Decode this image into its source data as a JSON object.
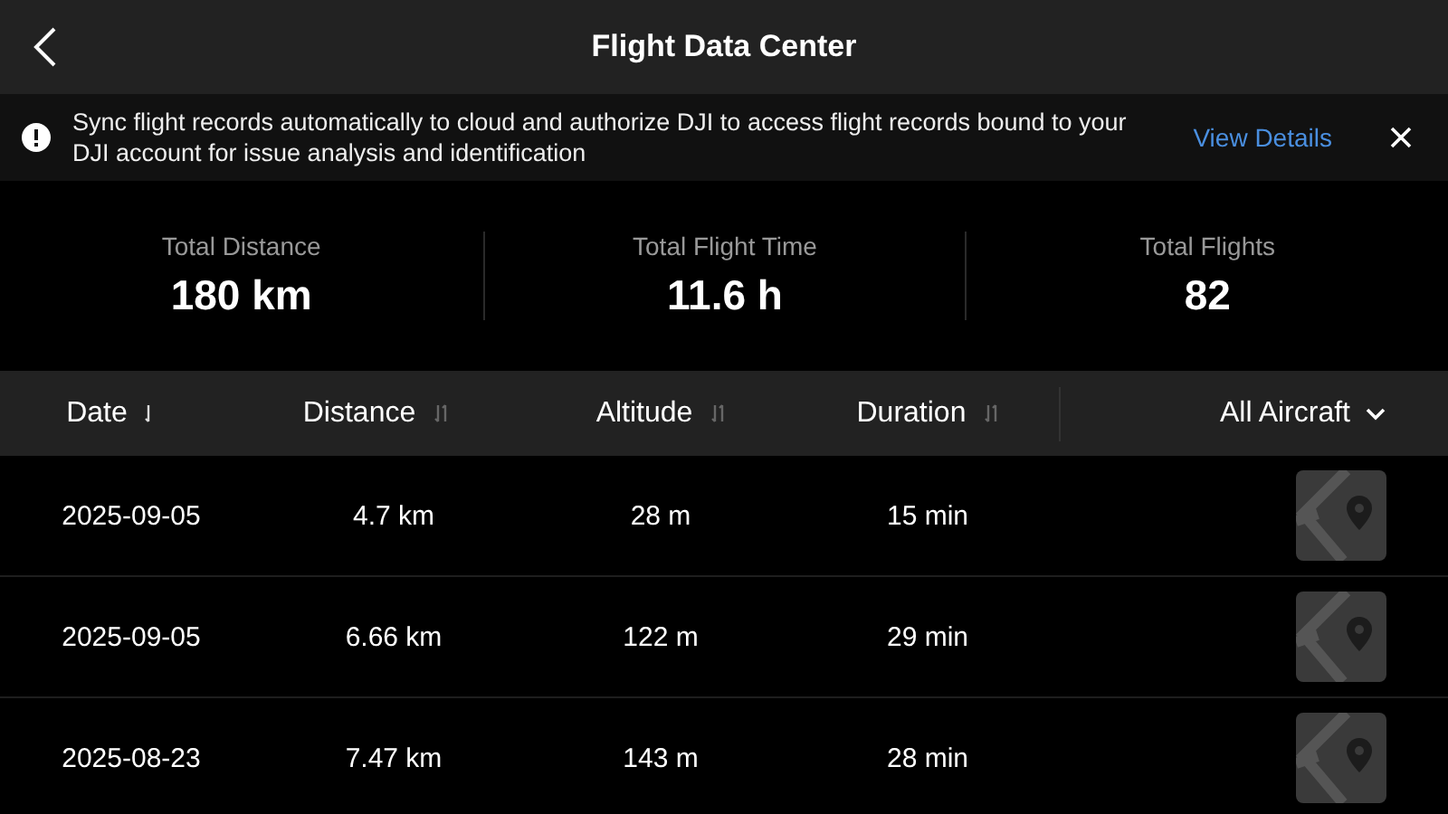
{
  "header": {
    "title": "Flight Data Center"
  },
  "banner": {
    "message": "Sync flight records automatically to cloud and authorize DJI to access flight records bound to your DJI account for issue analysis and identification",
    "link": "View Details"
  },
  "stats": [
    {
      "label": "Total Distance",
      "value": "180 km"
    },
    {
      "label": "Total Flight Time",
      "value": "11.6 h"
    },
    {
      "label": "Total Flights",
      "value": "82"
    }
  ],
  "table": {
    "columns": [
      {
        "label": "Date",
        "selected": true
      },
      {
        "label": "Distance",
        "selected": false
      },
      {
        "label": "Altitude",
        "selected": false
      },
      {
        "label": "Duration",
        "selected": false
      }
    ],
    "filter": "All Aircraft",
    "rows": [
      {
        "date": "2025-09-05",
        "distance": "4.7 km",
        "altitude": "28 m",
        "duration": "15 min"
      },
      {
        "date": "2025-09-05",
        "distance": "6.66 km",
        "altitude": "122 m",
        "duration": "29 min"
      },
      {
        "date": "2025-08-23",
        "distance": "7.47 km",
        "altitude": "143 m",
        "duration": "28 min"
      }
    ]
  }
}
